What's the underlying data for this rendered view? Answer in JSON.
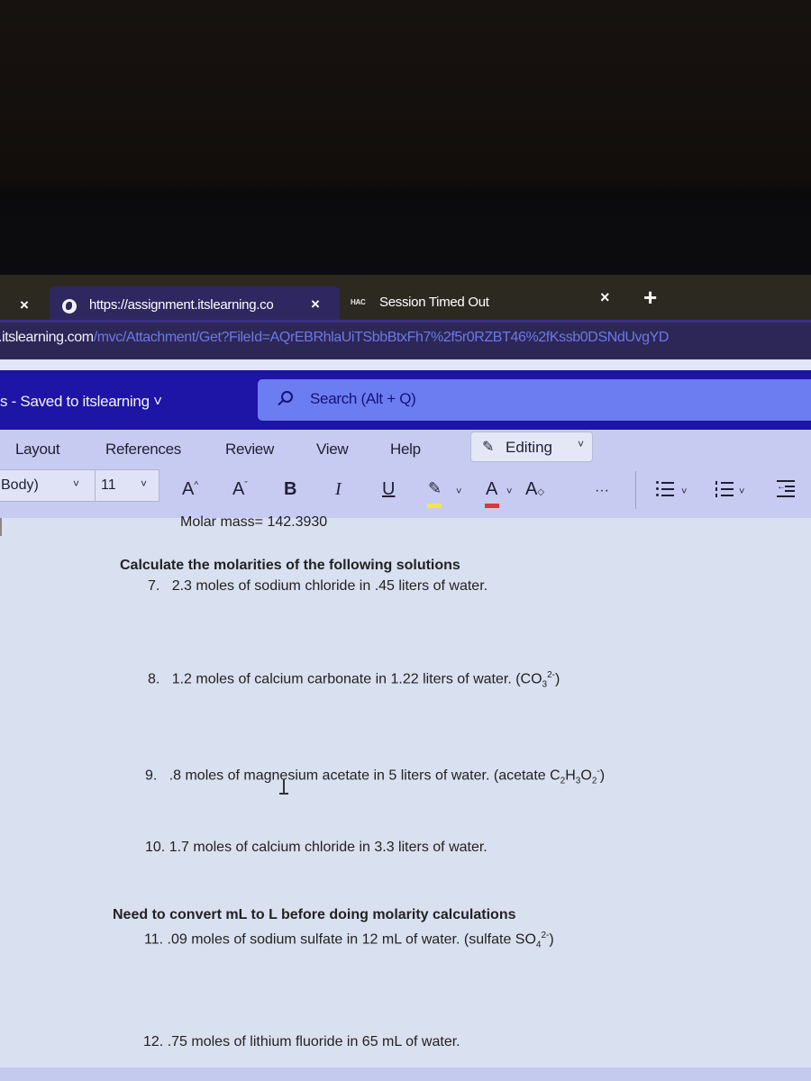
{
  "browser": {
    "tabs": [
      {
        "title": "https://assignment.itslearning.co",
        "favicon": "globe-icon",
        "active": true
      },
      {
        "title": "Session Timed Out",
        "favicon_text": "HAC",
        "active": false
      }
    ],
    "close_glyph": "×",
    "new_tab_glyph": "+",
    "address": {
      "host": "t.itslearning.com",
      "path": "/mvc/Attachment/Get?FileId=AQrEBRhlaUiTSbbBtxFh7%2f5r0RZBT46%2fKssb0DSNdUvgYD"
    }
  },
  "word": {
    "doc_title": "s - Saved to itslearning ˅",
    "search_placeholder": "Search (Alt + Q)",
    "menu": [
      "Layout",
      "References",
      "Review",
      "View",
      "Help"
    ],
    "editing_label": "Editing",
    "font_name": "Body)",
    "font_size": "11",
    "toolbar": {
      "grow_font": "A",
      "shrink_font": "A",
      "bold": "B",
      "italic": "I",
      "underline": "U",
      "font_color": "A",
      "clear_format": "A",
      "more": "···",
      "chevron": "˅"
    },
    "colors": {
      "highlight": "#f0e84a",
      "font_color": "#d8383a",
      "title_bar": "#1e14a6",
      "ribbon": "#c7cbf1"
    }
  },
  "document": {
    "molar_mass": "Molar mass= 142.3930",
    "heading1": "Calculate the molarities of the following solutions",
    "q7": {
      "num": "7.",
      "text": "2.3 moles of sodium chloride in .45 liters of water."
    },
    "q8": {
      "num": "8.",
      "text": "1.2 moles of calcium carbonate in 1.22 liters of water. (CO",
      "sub": "3",
      "sup": "2-",
      "end": ")"
    },
    "q9": {
      "num": "9.",
      "text": ".8 moles of magnesium acetate in 5 liters of water. (acetate C",
      "s1": "2",
      "m1": "H",
      "s2": "3",
      "m2": "O",
      "s3": "2",
      "sup": "-",
      "end": ")"
    },
    "q10": {
      "num": "10.",
      "text": "1.7 moles of calcium chloride in 3.3 liters of water."
    },
    "heading2": "Need to convert mL to L before doing molarity calculations",
    "q11": {
      "num": "11.",
      "text": ".09 moles of sodium sulfate in 12 mL of water. (sulfate SO",
      "sub": "4",
      "sup": "2-",
      "end": ")"
    },
    "q12": {
      "num": "12.",
      "text": ".75 moles of lithium fluoride in 65 mL of water."
    }
  }
}
